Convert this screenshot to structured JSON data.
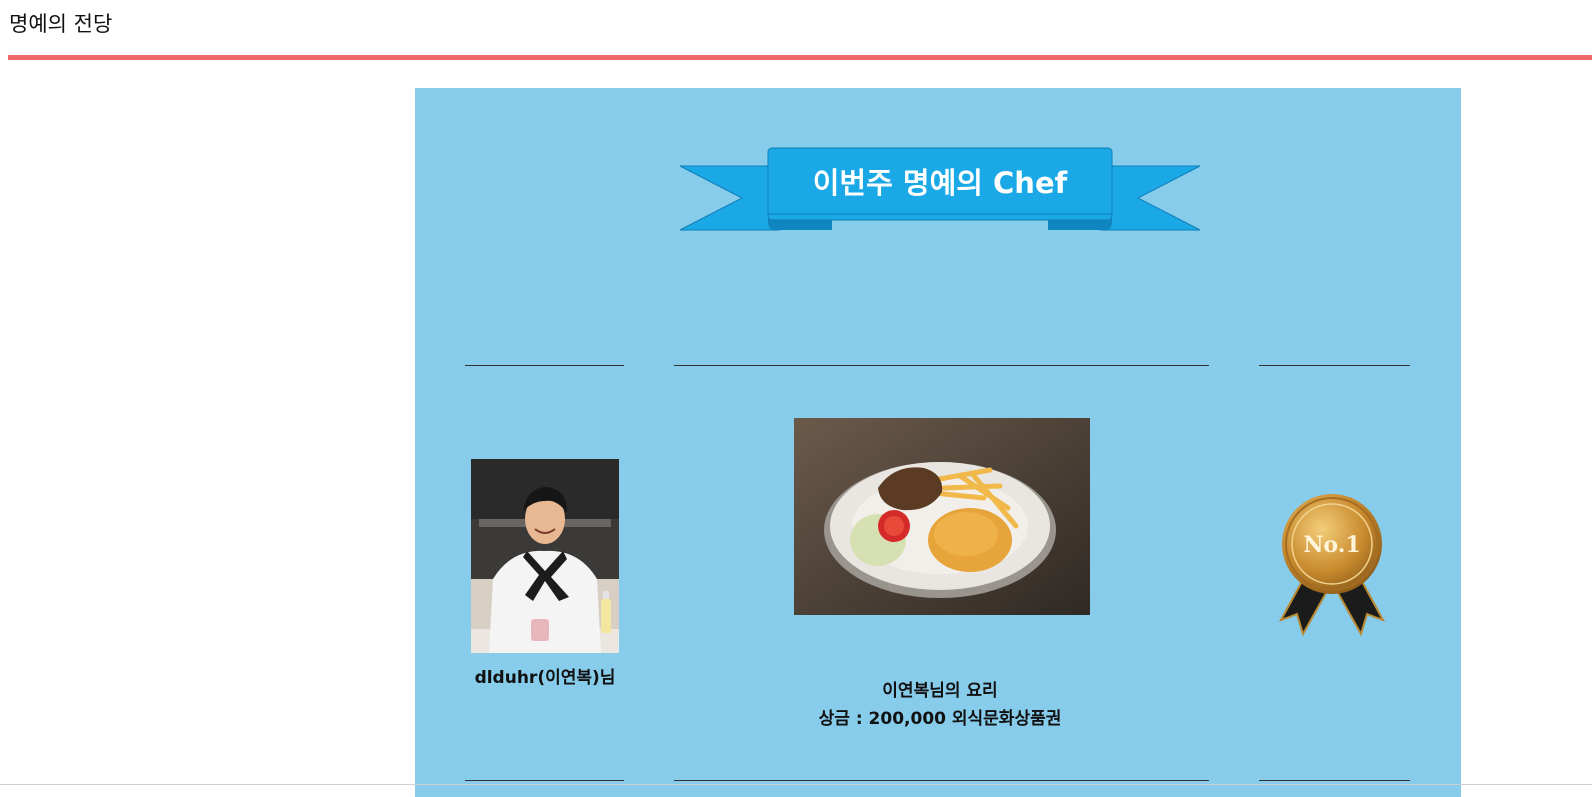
{
  "page": {
    "title": "명예의 전당"
  },
  "hall_of_fame": {
    "banner_title": "이번주 명예의 Chef",
    "chef": {
      "name_label": "dlduhr(이연복)님"
    },
    "dish": {
      "title": "이연복님의 요리",
      "prize": "상금 : 200,000 외식문화상품권"
    },
    "medal": {
      "text": "No.1"
    }
  },
  "colors": {
    "accent_rule": "#ef6b6b",
    "panel_background": "#87cceb",
    "banner_blue": "#1aa9e6",
    "medal_gold": "#c98b2e"
  },
  "icons": {
    "medal": "no1-medal-icon",
    "banner": "ribbon-banner-icon"
  }
}
